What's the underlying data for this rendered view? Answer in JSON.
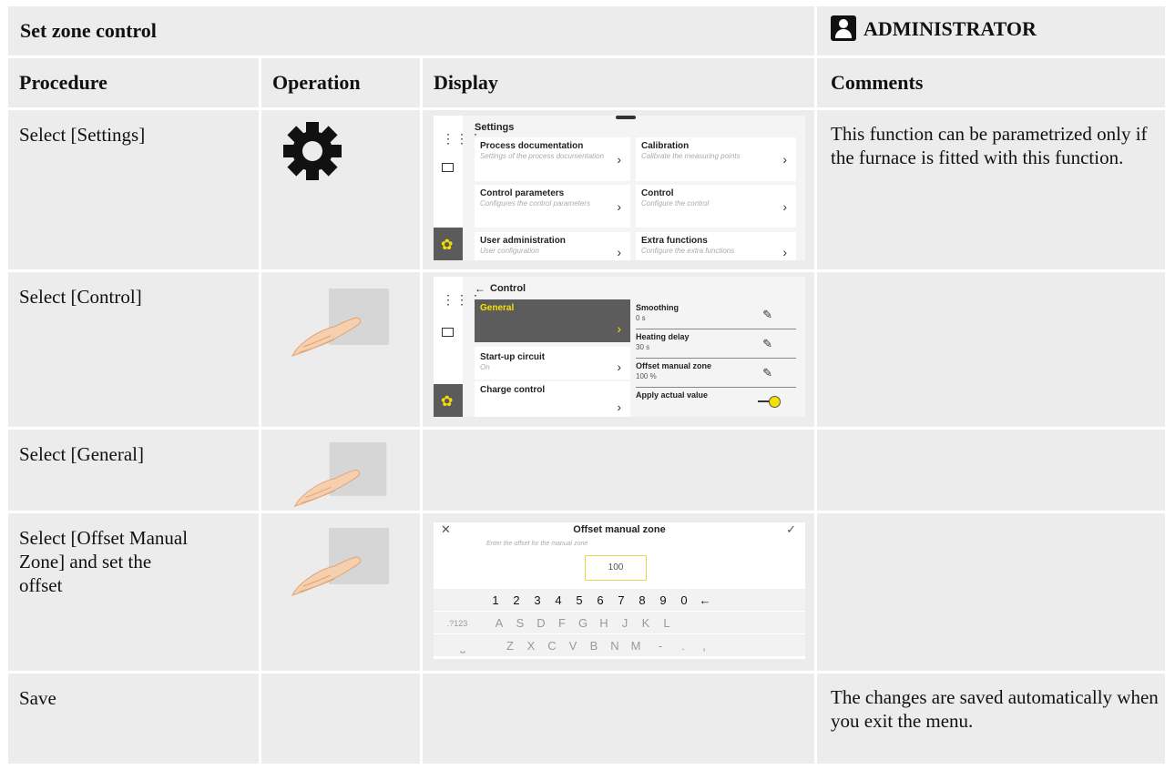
{
  "header": {
    "title": "Set zone control",
    "role": "ADMINISTRATOR"
  },
  "columns": [
    "Procedure",
    "Operation",
    "Display",
    "Comments"
  ],
  "rows": [
    {
      "procedure": "Select [Settings]",
      "operation_icon": "gear-icon",
      "comment": "This function can be parametrized only if the furnace is fitted with this function."
    },
    {
      "procedure": "Select [Control]",
      "operation_icon": "finger-touch-icon",
      "comment": ""
    },
    {
      "procedure": "Select [General]",
      "operation_icon": "finger-touch-icon",
      "comment": ""
    },
    {
      "procedure_lines": [
        "Select [Offset Manual",
        "Zone] and set the",
        "offset"
      ],
      "operation_icon": "finger-touch-icon",
      "comment": ""
    },
    {
      "procedure": "Save",
      "operation_icon": "",
      "comment": "The changes are saved automatically when you exit the menu."
    }
  ],
  "screen_settings": {
    "title": "Settings",
    "tiles": [
      {
        "title": "Process documentation",
        "subtitle": "Settings of the process documentation"
      },
      {
        "title": "Calibration",
        "subtitle": "Calibrate the measuring points"
      },
      {
        "title": "Control parameters",
        "subtitle": "Configures the control parameters"
      },
      {
        "title": "Control",
        "subtitle": "Configure the control"
      },
      {
        "title": "User administration",
        "subtitle": "User configuration"
      },
      {
        "title": "Extra functions",
        "subtitle": "Configure the extra functions"
      }
    ]
  },
  "screen_control": {
    "title": "Control",
    "menu": [
      {
        "title": "General",
        "subtitle": ""
      },
      {
        "title": "Start-up circuit",
        "subtitle": "On"
      },
      {
        "title": "Charge control",
        "subtitle": ""
      }
    ],
    "params": [
      {
        "title": "Smoothing",
        "value": "0 s"
      },
      {
        "title": "Heating delay",
        "value": "30 s"
      },
      {
        "title": "Offset manual zone",
        "value": "100 %"
      },
      {
        "title": "Apply actual value",
        "value": ""
      }
    ]
  },
  "screen_keyboard": {
    "title": "Offset manual zone",
    "hint": "Enter the offset for the manual zone",
    "value": "100",
    "row1": [
      "1",
      "2",
      "3",
      "4",
      "5",
      "6",
      "7",
      "8",
      "9",
      "0",
      "←"
    ],
    "row2": [
      ".?123",
      "A",
      "S",
      "D",
      "F",
      "G",
      "H",
      "J",
      "K",
      "L"
    ],
    "row3": [
      "⎵",
      "Z",
      "X",
      "C",
      "V",
      "B",
      "N",
      "M",
      "-",
      ".",
      ","
    ]
  }
}
